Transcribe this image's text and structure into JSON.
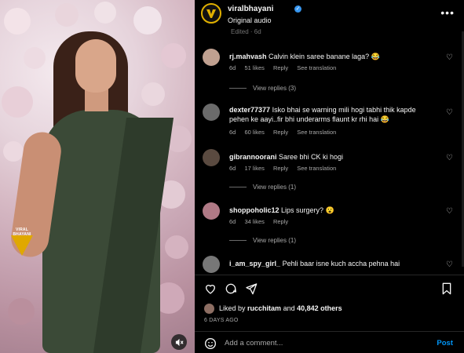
{
  "header": {
    "username": "viralbhayani",
    "subtitle": "Original audio",
    "more_label": "•••"
  },
  "media": {
    "watermark_text": "VIRAL BHAYANI"
  },
  "edited_note": "Edited · 6d",
  "comments": [
    {
      "user": "rj.mahvash",
      "text": "Calvin klein saree banane laga? 😂",
      "time": "6d",
      "likes": "51 likes",
      "reply": "Reply",
      "translate": "See translation",
      "replies": "View replies (3)",
      "avatar_color": "#c0a090"
    },
    {
      "user": "dexter77377",
      "text": "Isko bhai se warning mili hogi tabhi thik kapde pehen ke aayi..fir bhi underarms flaunt kr rhi hai 😂",
      "time": "6d",
      "likes": "60 likes",
      "reply": "Reply",
      "translate": "See translation",
      "replies": "",
      "avatar_color": "#6b6b6b"
    },
    {
      "user": "gibrannoorani",
      "text": "Saree bhi CK ki hogi",
      "time": "6d",
      "likes": "17 likes",
      "reply": "Reply",
      "translate": "See translation",
      "replies": "View replies (1)",
      "avatar_color": "#5a4a40"
    },
    {
      "user": "shoppoholic12",
      "text": "Lips surgery? 😮",
      "time": "6d",
      "likes": "34 likes",
      "reply": "Reply",
      "translate": "",
      "replies": "View replies (1)",
      "avatar_color": "#b07a86"
    },
    {
      "user": "i_am_spy_girl_",
      "text": "Pehli baar isne kuch accha pehna hai",
      "time": "",
      "likes": "",
      "reply": "",
      "translate": "",
      "replies": "",
      "avatar_color": "#777777"
    }
  ],
  "likes": {
    "prefix": "Liked by",
    "user": "rucchitam",
    "middle": "and",
    "others": "40,842 others"
  },
  "date": "6 DAYS AGO",
  "add_comment": {
    "placeholder": "Add a comment...",
    "post_label": "Post"
  },
  "colors": {
    "accent": "#0095f6",
    "verified": "#3897f0",
    "brand": "#e0b000"
  }
}
